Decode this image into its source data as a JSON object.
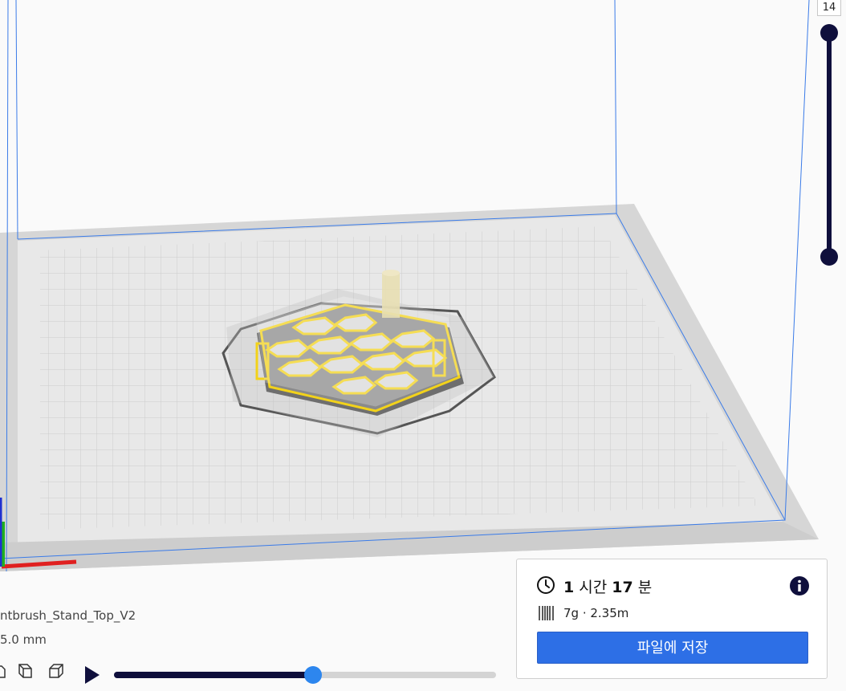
{
  "layer_view": {
    "current_layer": "14"
  },
  "object": {
    "name": "ntbrush_Stand_Top_V2",
    "dimensions": "5.0 mm"
  },
  "print_info": {
    "time_hours": "1",
    "time_hours_unit": "시간",
    "time_minutes": "17",
    "time_minutes_unit": "분",
    "material": "7g · 2.35m",
    "save_label": "파일에 저장"
  },
  "simulation": {
    "progress_fraction": 0.52
  },
  "colors": {
    "accent": "#2d6fe6",
    "dark": "#0f0f3c",
    "filament": "#f2d21a"
  }
}
